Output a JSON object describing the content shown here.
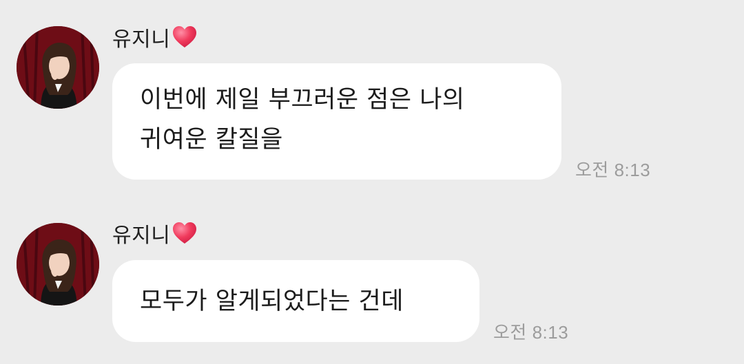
{
  "colors": {
    "background": "#ececec",
    "bubble": "#ffffff",
    "heart": "#f03a5c",
    "timestamp": "#9c9c9c"
  },
  "messages": [
    {
      "sender": "유지니",
      "sender_icon": "heart-icon",
      "lines": [
        "이번에 제일 부끄러운 점은 나의",
        "귀여운 칼질을"
      ],
      "time": "오전 8:13"
    },
    {
      "sender": "유지니",
      "sender_icon": "heart-icon",
      "lines": [
        "모두가 알게되었다는 건데"
      ],
      "time": "오전 8:13"
    }
  ]
}
